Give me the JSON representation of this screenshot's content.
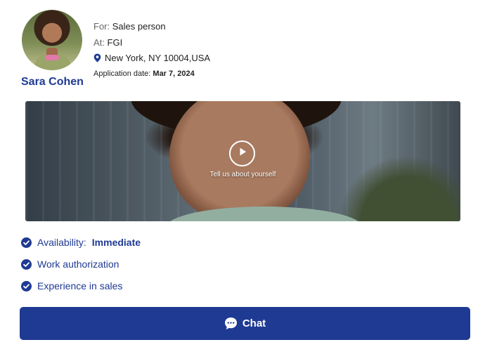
{
  "candidate": {
    "name": "Sara Cohen",
    "for_label": "For:",
    "for_value": "Sales person",
    "at_label": "At:",
    "at_value": "FGI",
    "location": "New York, NY 10004,USA",
    "date_label": "Application date:",
    "date_value": "Mar 7, 2024"
  },
  "video": {
    "caption": "Tell us about yourself",
    "icon": "play-icon"
  },
  "qualifications": [
    {
      "label": "Availability:",
      "value": "Immediate",
      "icon": "check-circle-icon"
    },
    {
      "label": "Work authorization",
      "icon": "check-circle-icon"
    },
    {
      "label": "Experience in sales",
      "icon": "check-circle-icon"
    }
  ],
  "chat_button": {
    "label": "Chat",
    "icon": "chat-bubble-icon"
  },
  "colors": {
    "brand": "#1f3a93",
    "background": "#ffffff"
  }
}
